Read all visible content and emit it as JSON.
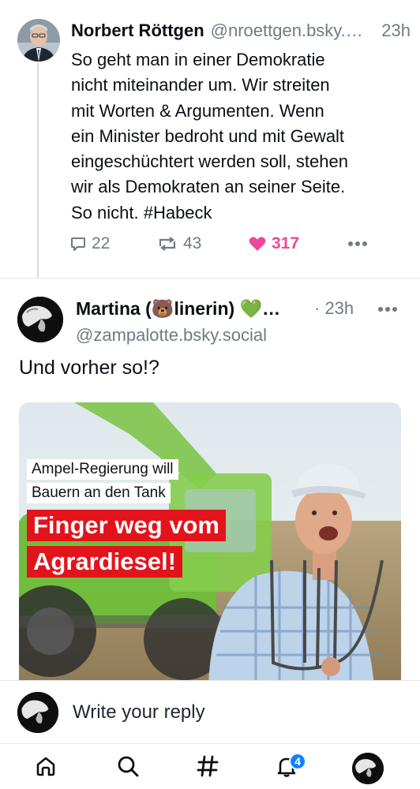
{
  "post1": {
    "author_name": "Norbert Röttgen",
    "author_handle": "@nroettgen.bsky.…",
    "time": "23h",
    "text_lines": [
      "So geht man in einer Demokratie",
      "nicht miteinander um. Wir streiten",
      "mit Worten & Argumenten. Wenn",
      "ein Minister bedroht und mit Gewalt",
      "eingeschüchtert werden soll, stehen",
      "wir als Demokraten an seiner Seite.",
      "So nicht. #Habeck"
    ],
    "actions": {
      "reply_count": "22",
      "repost_count": "43",
      "like_count": "317",
      "reply_icon": "reply-bubble-icon",
      "repost_icon": "repost-icon",
      "like_icon": "heart-filled-icon",
      "more_icon": "more-dots-icon"
    }
  },
  "post2": {
    "author_name": "Martina (🐻linerin) 💚…",
    "time": "· 23h",
    "author_handle": "@zampalotte.bsky.social",
    "text": "Und vorher so!?",
    "image": {
      "caption_line1": "Ampel-Regierung will",
      "caption_line2": "Bauern an den Tank",
      "headline_line1": "Finger weg vom",
      "headline_line2": "Agrardiesel!"
    }
  },
  "reply_bar": {
    "placeholder": "Write your reply"
  },
  "nav": {
    "items": [
      "home-icon",
      "search-icon",
      "feeds-hash-icon",
      "notifications-icon",
      "profile-avatar"
    ],
    "notification_badge": "4"
  },
  "colors": {
    "like_pink": "#ec4899",
    "muted_text": "#6f7a86",
    "badge_blue": "#1083fe",
    "headline_red": "#e3131b"
  }
}
